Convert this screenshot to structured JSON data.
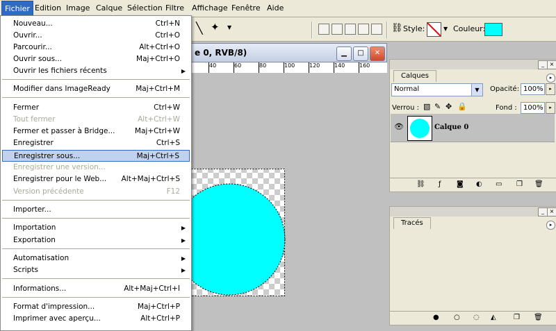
{
  "menubar": {
    "items": [
      "Fichier",
      "Edition",
      "Image",
      "Calque",
      "Sélection",
      "Filtre",
      "Affichage",
      "Fenêtre",
      "Aide"
    ]
  },
  "options": {
    "style_label": "Style:",
    "couleur_label": "Couleur:",
    "couleur_color": "#00ffff"
  },
  "document": {
    "title": "e 0, RVB/8)",
    "ruler": [
      "40",
      "60",
      "80",
      "100",
      "120",
      "140",
      "160"
    ]
  },
  "menu": {
    "items": [
      {
        "label": "Nouveau...",
        "shortcut": "Ctrl+N"
      },
      {
        "label": "Ouvrir...",
        "shortcut": "Ctrl+O"
      },
      {
        "label": "Parcourir...",
        "shortcut": "Alt+Ctrl+O"
      },
      {
        "label": "Ouvrir sous...",
        "shortcut": "Maj+Ctrl+O"
      },
      {
        "label": "Ouvrir les fichiers récents",
        "shortcut": ""
      },
      {
        "label": "Modifier dans ImageReady",
        "shortcut": "Maj+Ctrl+M"
      },
      {
        "label": "Fermer",
        "shortcut": "Ctrl+W"
      },
      {
        "label": "Tout fermer",
        "shortcut": "Alt+Ctrl+W"
      },
      {
        "label": "Fermer et passer à Bridge...",
        "shortcut": "Maj+Ctrl+W"
      },
      {
        "label": "Enregistrer",
        "shortcut": "Ctrl+S"
      },
      {
        "label": "Enregistrer sous...",
        "shortcut": "Maj+Ctrl+S"
      },
      {
        "label": "Enregistrer une version...",
        "shortcut": ""
      },
      {
        "label": "Enregistrer pour le Web...",
        "shortcut": "Alt+Maj+Ctrl+S"
      },
      {
        "label": "Version précédente",
        "shortcut": "F12"
      },
      {
        "label": "Importer...",
        "shortcut": ""
      },
      {
        "label": "Importation",
        "shortcut": ""
      },
      {
        "label": "Exportation",
        "shortcut": ""
      },
      {
        "label": "Automatisation",
        "shortcut": ""
      },
      {
        "label": "Scripts",
        "shortcut": ""
      },
      {
        "label": "Informations...",
        "shortcut": "Alt+Maj+Ctrl+I"
      },
      {
        "label": "Format d'impression...",
        "shortcut": "Maj+Ctrl+P"
      },
      {
        "label": "Imprimer avec aperçu...",
        "shortcut": "Alt+Ctrl+P"
      }
    ]
  },
  "layers_panel": {
    "tab": "Calques",
    "blend": "Normal",
    "opacity_label": "Opacité:",
    "opacity": "100%",
    "lock_label": "Verrou :",
    "fill_label": "Fond :",
    "fill": "100%",
    "layer_name": "Calque 0"
  },
  "paths_panel": {
    "tab": "Tracés"
  }
}
